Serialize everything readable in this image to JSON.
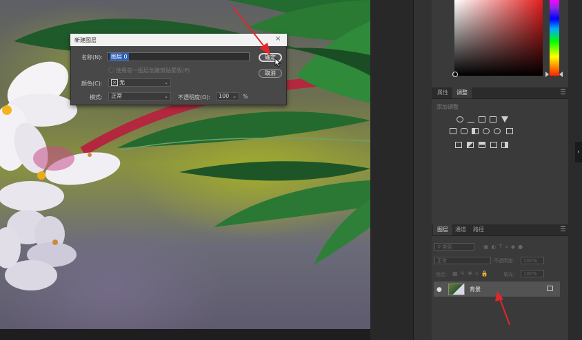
{
  "dialog": {
    "title": "新建图层",
    "name_label": "名称(N):",
    "name_value": "图层 0",
    "clip_label": "使用前一图层创建剪贴蒙版(P)",
    "color_label": "颜色(C):",
    "color_value": "无",
    "mode_label": "模式:",
    "mode_value": "正常",
    "opacity_label": "不透明度(O):",
    "opacity_value": "100",
    "opacity_unit": "%",
    "ok_label": "确定",
    "cancel_label": "取消",
    "close_glyph": "×"
  },
  "adjust_panel": {
    "tabs": [
      "属性",
      "调整"
    ],
    "active_tab": "调整",
    "subtitle": "添加调整"
  },
  "layers_panel": {
    "tabs": [
      "图层",
      "通道",
      "路径"
    ],
    "filter_placeholder": "类型",
    "blend_mode": "正常",
    "opacity_label": "不透明度:",
    "opacity_value": "100%",
    "lock_label": "锁定:",
    "fill_label": "填充:",
    "fill_value": "100%",
    "layer_name": "背景"
  },
  "colors": {
    "annotation_red": "#e3262b",
    "panel_bg": "#3a3a3a",
    "selection_blue": "#2d5eb8"
  },
  "icons": [
    "eye-icon",
    "lock-icon",
    "panel-menu-icon",
    "collapse-chevron-icon",
    "adjustment-icons"
  ]
}
